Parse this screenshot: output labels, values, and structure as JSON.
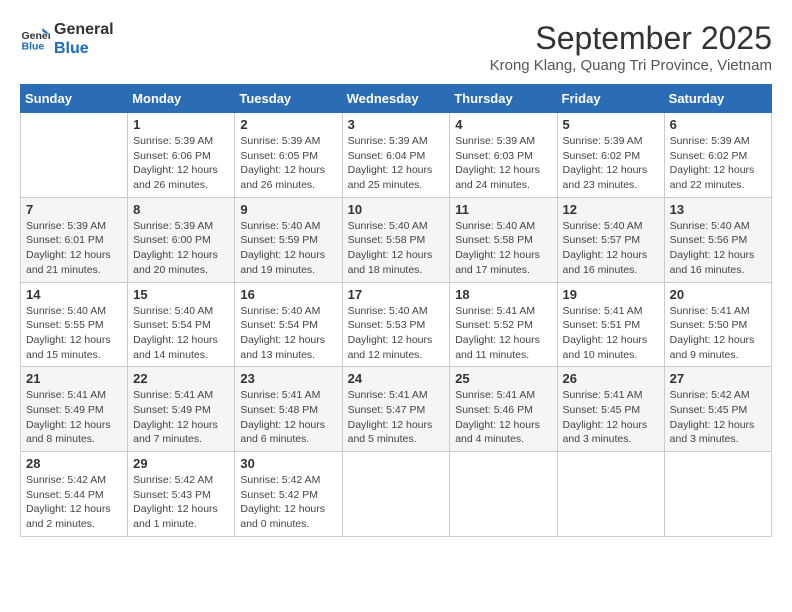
{
  "logo": {
    "line1": "General",
    "line2": "Blue"
  },
  "title": "September 2025",
  "subtitle": "Krong Klang, Quang Tri Province, Vietnam",
  "weekdays": [
    "Sunday",
    "Monday",
    "Tuesday",
    "Wednesday",
    "Thursday",
    "Friday",
    "Saturday"
  ],
  "weeks": [
    [
      {
        "day": "",
        "sunrise": "",
        "sunset": "",
        "daylight": ""
      },
      {
        "day": "1",
        "sunrise": "Sunrise: 5:39 AM",
        "sunset": "Sunset: 6:06 PM",
        "daylight": "Daylight: 12 hours and 26 minutes."
      },
      {
        "day": "2",
        "sunrise": "Sunrise: 5:39 AM",
        "sunset": "Sunset: 6:05 PM",
        "daylight": "Daylight: 12 hours and 26 minutes."
      },
      {
        "day": "3",
        "sunrise": "Sunrise: 5:39 AM",
        "sunset": "Sunset: 6:04 PM",
        "daylight": "Daylight: 12 hours and 25 minutes."
      },
      {
        "day": "4",
        "sunrise": "Sunrise: 5:39 AM",
        "sunset": "Sunset: 6:03 PM",
        "daylight": "Daylight: 12 hours and 24 minutes."
      },
      {
        "day": "5",
        "sunrise": "Sunrise: 5:39 AM",
        "sunset": "Sunset: 6:02 PM",
        "daylight": "Daylight: 12 hours and 23 minutes."
      },
      {
        "day": "6",
        "sunrise": "Sunrise: 5:39 AM",
        "sunset": "Sunset: 6:02 PM",
        "daylight": "Daylight: 12 hours and 22 minutes."
      }
    ],
    [
      {
        "day": "7",
        "sunrise": "Sunrise: 5:39 AM",
        "sunset": "Sunset: 6:01 PM",
        "daylight": "Daylight: 12 hours and 21 minutes."
      },
      {
        "day": "8",
        "sunrise": "Sunrise: 5:39 AM",
        "sunset": "Sunset: 6:00 PM",
        "daylight": "Daylight: 12 hours and 20 minutes."
      },
      {
        "day": "9",
        "sunrise": "Sunrise: 5:40 AM",
        "sunset": "Sunset: 5:59 PM",
        "daylight": "Daylight: 12 hours and 19 minutes."
      },
      {
        "day": "10",
        "sunrise": "Sunrise: 5:40 AM",
        "sunset": "Sunset: 5:58 PM",
        "daylight": "Daylight: 12 hours and 18 minutes."
      },
      {
        "day": "11",
        "sunrise": "Sunrise: 5:40 AM",
        "sunset": "Sunset: 5:58 PM",
        "daylight": "Daylight: 12 hours and 17 minutes."
      },
      {
        "day": "12",
        "sunrise": "Sunrise: 5:40 AM",
        "sunset": "Sunset: 5:57 PM",
        "daylight": "Daylight: 12 hours and 16 minutes."
      },
      {
        "day": "13",
        "sunrise": "Sunrise: 5:40 AM",
        "sunset": "Sunset: 5:56 PM",
        "daylight": "Daylight: 12 hours and 16 minutes."
      }
    ],
    [
      {
        "day": "14",
        "sunrise": "Sunrise: 5:40 AM",
        "sunset": "Sunset: 5:55 PM",
        "daylight": "Daylight: 12 hours and 15 minutes."
      },
      {
        "day": "15",
        "sunrise": "Sunrise: 5:40 AM",
        "sunset": "Sunset: 5:54 PM",
        "daylight": "Daylight: 12 hours and 14 minutes."
      },
      {
        "day": "16",
        "sunrise": "Sunrise: 5:40 AM",
        "sunset": "Sunset: 5:54 PM",
        "daylight": "Daylight: 12 hours and 13 minutes."
      },
      {
        "day": "17",
        "sunrise": "Sunrise: 5:40 AM",
        "sunset": "Sunset: 5:53 PM",
        "daylight": "Daylight: 12 hours and 12 minutes."
      },
      {
        "day": "18",
        "sunrise": "Sunrise: 5:41 AM",
        "sunset": "Sunset: 5:52 PM",
        "daylight": "Daylight: 12 hours and 11 minutes."
      },
      {
        "day": "19",
        "sunrise": "Sunrise: 5:41 AM",
        "sunset": "Sunset: 5:51 PM",
        "daylight": "Daylight: 12 hours and 10 minutes."
      },
      {
        "day": "20",
        "sunrise": "Sunrise: 5:41 AM",
        "sunset": "Sunset: 5:50 PM",
        "daylight": "Daylight: 12 hours and 9 minutes."
      }
    ],
    [
      {
        "day": "21",
        "sunrise": "Sunrise: 5:41 AM",
        "sunset": "Sunset: 5:49 PM",
        "daylight": "Daylight: 12 hours and 8 minutes."
      },
      {
        "day": "22",
        "sunrise": "Sunrise: 5:41 AM",
        "sunset": "Sunset: 5:49 PM",
        "daylight": "Daylight: 12 hours and 7 minutes."
      },
      {
        "day": "23",
        "sunrise": "Sunrise: 5:41 AM",
        "sunset": "Sunset: 5:48 PM",
        "daylight": "Daylight: 12 hours and 6 minutes."
      },
      {
        "day": "24",
        "sunrise": "Sunrise: 5:41 AM",
        "sunset": "Sunset: 5:47 PM",
        "daylight": "Daylight: 12 hours and 5 minutes."
      },
      {
        "day": "25",
        "sunrise": "Sunrise: 5:41 AM",
        "sunset": "Sunset: 5:46 PM",
        "daylight": "Daylight: 12 hours and 4 minutes."
      },
      {
        "day": "26",
        "sunrise": "Sunrise: 5:41 AM",
        "sunset": "Sunset: 5:45 PM",
        "daylight": "Daylight: 12 hours and 3 minutes."
      },
      {
        "day": "27",
        "sunrise": "Sunrise: 5:42 AM",
        "sunset": "Sunset: 5:45 PM",
        "daylight": "Daylight: 12 hours and 3 minutes."
      }
    ],
    [
      {
        "day": "28",
        "sunrise": "Sunrise: 5:42 AM",
        "sunset": "Sunset: 5:44 PM",
        "daylight": "Daylight: 12 hours and 2 minutes."
      },
      {
        "day": "29",
        "sunrise": "Sunrise: 5:42 AM",
        "sunset": "Sunset: 5:43 PM",
        "daylight": "Daylight: 12 hours and 1 minute."
      },
      {
        "day": "30",
        "sunrise": "Sunrise: 5:42 AM",
        "sunset": "Sunset: 5:42 PM",
        "daylight": "Daylight: 12 hours and 0 minutes."
      },
      {
        "day": "",
        "sunrise": "",
        "sunset": "",
        "daylight": ""
      },
      {
        "day": "",
        "sunrise": "",
        "sunset": "",
        "daylight": ""
      },
      {
        "day": "",
        "sunrise": "",
        "sunset": "",
        "daylight": ""
      },
      {
        "day": "",
        "sunrise": "",
        "sunset": "",
        "daylight": ""
      }
    ]
  ]
}
